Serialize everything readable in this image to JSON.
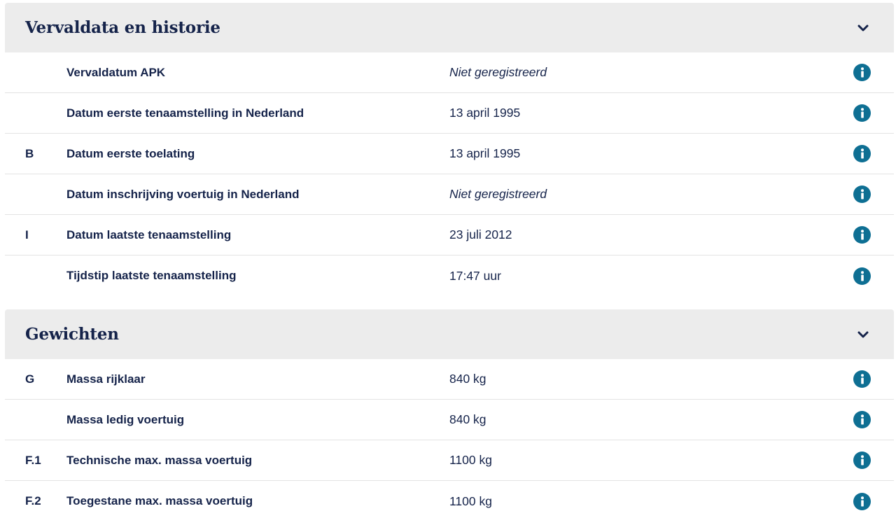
{
  "sections": [
    {
      "title": "Vervaldata en historie",
      "rows": [
        {
          "code": "",
          "label": "Vervaldatum APK",
          "value": "Niet geregistreerd",
          "italic": true
        },
        {
          "code": "",
          "label": "Datum eerste tenaamstelling in Nederland",
          "value": "13 april 1995",
          "italic": false
        },
        {
          "code": "B",
          "label": "Datum eerste toelating",
          "value": "13 april 1995",
          "italic": false
        },
        {
          "code": "",
          "label": "Datum inschrijving voertuig in Nederland",
          "value": "Niet geregistreerd",
          "italic": true
        },
        {
          "code": "I",
          "label": "Datum laatste tenaamstelling",
          "value": "23 juli 2012",
          "italic": false
        },
        {
          "code": "",
          "label": "Tijdstip laatste tenaamstelling",
          "value": "17:47 uur",
          "italic": false
        }
      ]
    },
    {
      "title": "Gewichten",
      "rows": [
        {
          "code": "G",
          "label": "Massa rijklaar",
          "value": "840 kg",
          "italic": false
        },
        {
          "code": "",
          "label": "Massa ledig voertuig",
          "value": "840 kg",
          "italic": false
        },
        {
          "code": "F.1",
          "label": "Technische max. massa voertuig",
          "value": "1100 kg",
          "italic": false
        },
        {
          "code": "F.2",
          "label": "Toegestane max. massa voertuig",
          "value": "1100 kg",
          "italic": false
        }
      ]
    }
  ],
  "icons": {
    "toggle": "chevron-down-icon",
    "info": "info-icon"
  },
  "colors": {
    "text": "#15234a",
    "header_bg": "#ececec",
    "info_icon": "#0e6f93",
    "divider": "#e3e3e3"
  }
}
